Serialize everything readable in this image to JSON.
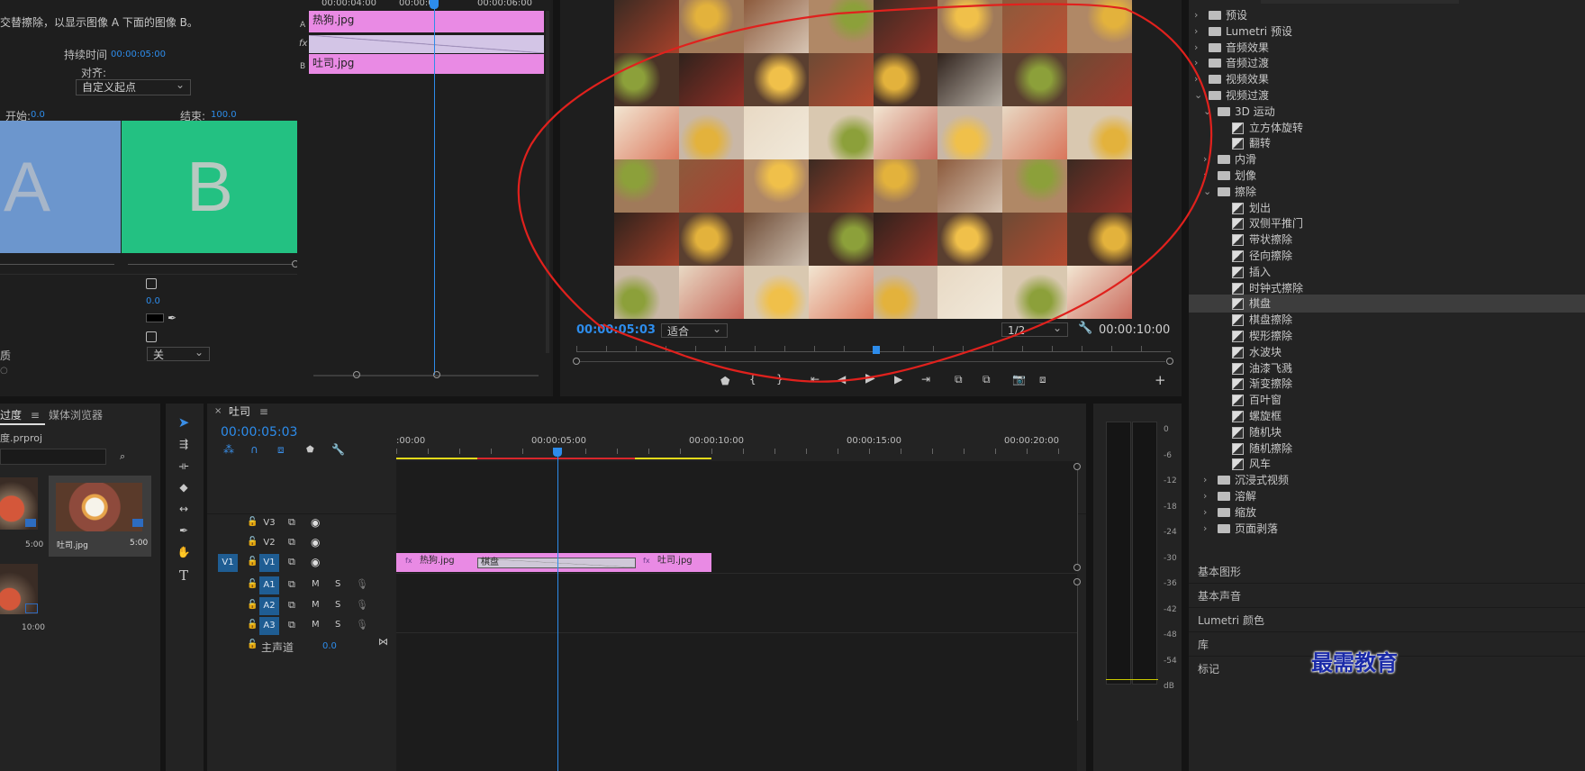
{
  "effect_controls": {
    "description": "交替擦除，以显示图像 A 下面的图像 B。",
    "duration_label": "持续时间",
    "duration_value": "00:00:05:00",
    "align_label": "对齐:",
    "align_value": "自定义起点",
    "start_label": "开始:",
    "start_value": "0.0",
    "end_label": "结束:",
    "end_value": "100.0",
    "preview_a": "A",
    "preview_b": "B",
    "param_value_1": "0.0",
    "quality_label": "质",
    "quality_value": "关"
  },
  "mini_timeline": {
    "ruler": [
      "00:00:04:00",
      "00:00:0",
      "00:00:06:00"
    ],
    "track_a_clip": "热狗.jpg",
    "track_b_clip": "吐司.jpg",
    "track_a_label": "A",
    "track_fx_label": "fx",
    "track_b_label": "B"
  },
  "program_monitor": {
    "current_time": "00:00:05:03",
    "fit_value": "适合",
    "resolution_value": "1/2",
    "duration": "00:00:10:00"
  },
  "effects_tree": {
    "top_items": [
      "预设",
      "Lumetri 预设",
      "音频效果",
      "音频过渡",
      "视频效果",
      "视频过渡"
    ],
    "folder_3d": "3D 运动",
    "items_3d": [
      "立方体旋转",
      "翻转"
    ],
    "folder_slide": "内滑",
    "folder_iris": "划像",
    "folder_wipe": "擦除",
    "wipe_items": [
      "划出",
      "双侧平推门",
      "带状擦除",
      "径向擦除",
      "插入",
      "时钟式擦除",
      "棋盘",
      "棋盘擦除",
      "楔形擦除",
      "水波块",
      "油漆飞溅",
      "渐变擦除",
      "百叶窗",
      "螺旋框",
      "随机块",
      "随机擦除",
      "风车"
    ],
    "selected_item": "棋盘",
    "after_items": [
      "沉浸式视频",
      "溶解",
      "缩放",
      "页面剥落"
    ]
  },
  "workspace_panels": [
    "基本图形",
    "基本声音",
    "Lumetri 颜色",
    "库",
    "标记"
  ],
  "project_panel": {
    "tab_active": "过度",
    "tab_media": "媒体浏览器",
    "project_file": "度.prproj",
    "item1_duration": "5:00",
    "item2_name": "吐司.jpg",
    "item2_duration": "5:00",
    "item3_duration": "10:00"
  },
  "sequence": {
    "tab_name": "吐司",
    "timecode": "00:00:05:03",
    "ruler": [
      ":00:00",
      "00:00:05:00",
      "00:00:10:00",
      "00:00:15:00",
      "00:00:20:00"
    ],
    "video_tracks": [
      "V3",
      "V2",
      "V1"
    ],
    "source_patch": "V1",
    "audio_tracks": [
      "A1",
      "A2",
      "A3"
    ],
    "mute_label": "M",
    "solo_label": "S",
    "master_label": "主声道",
    "master_value": "0.0",
    "clip1": "热狗.jpg",
    "transition": "棋盘",
    "clip2": "吐司.jpg"
  },
  "audio_meter": {
    "scale": [
      "0",
      "-6",
      "-12",
      "-18",
      "-24",
      "-30",
      "-36",
      "-42",
      "-48",
      "-54",
      "dB"
    ]
  },
  "watermark": "最需教育",
  "colors": {
    "accent_blue": "#2d8ceb",
    "clip_pink": "#e98ae4",
    "preview_a_bg": "#6c96cd",
    "preview_b_bg": "#23c182",
    "annotation_red": "#e0211d"
  }
}
